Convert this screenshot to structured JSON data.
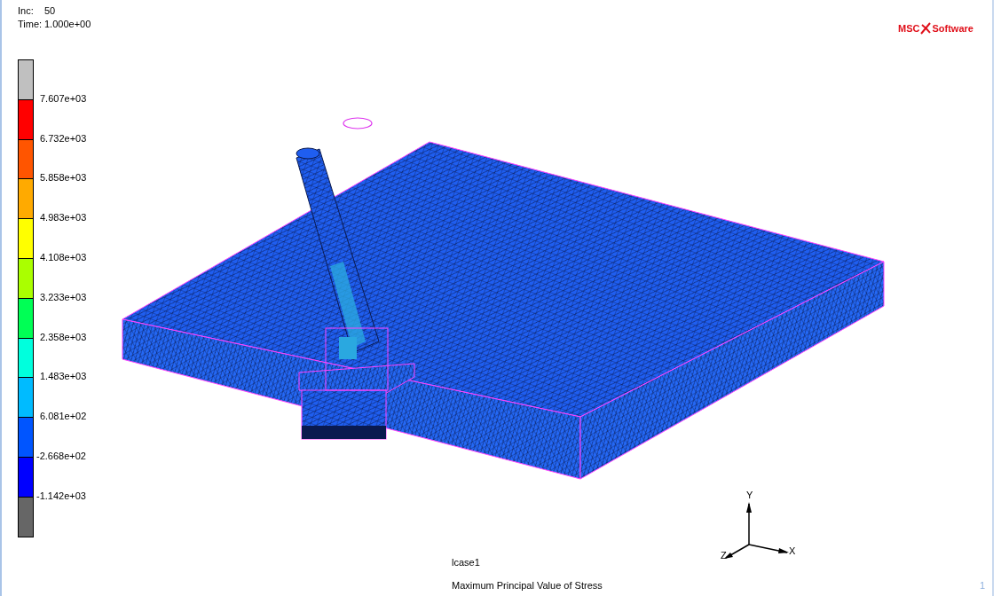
{
  "header": {
    "increment_label": "Inc:",
    "increment": "50",
    "time_label": "Time:",
    "time": "1.000e+00"
  },
  "logo": {
    "left": "MSC",
    "right": "Software"
  },
  "legend": {
    "bands": [
      {
        "color": "#c0c0c0"
      },
      {
        "color": "#ff0000"
      },
      {
        "color": "#ff5500"
      },
      {
        "color": "#ffaa00"
      },
      {
        "color": "#ffff00"
      },
      {
        "color": "#aaff00"
      },
      {
        "color": "#00ff55"
      },
      {
        "color": "#00ffdd"
      },
      {
        "color": "#00bbff"
      },
      {
        "color": "#0055ff"
      },
      {
        "color": "#0000ff"
      },
      {
        "color": "#666666"
      }
    ],
    "labels": [
      "7.607e+03",
      "6.732e+03",
      "5.858e+03",
      "4.983e+03",
      "4.108e+03",
      "3.233e+03",
      "2.358e+03",
      "1.483e+03",
      "6.081e+02",
      "-2.668e+02",
      "-1.142e+03"
    ]
  },
  "axes": {
    "y": "Y",
    "x": "X",
    "z": "Z"
  },
  "load_case": "lcase1",
  "result_title": "Maximum Principal Value of Stress",
  "page_number": "1"
}
